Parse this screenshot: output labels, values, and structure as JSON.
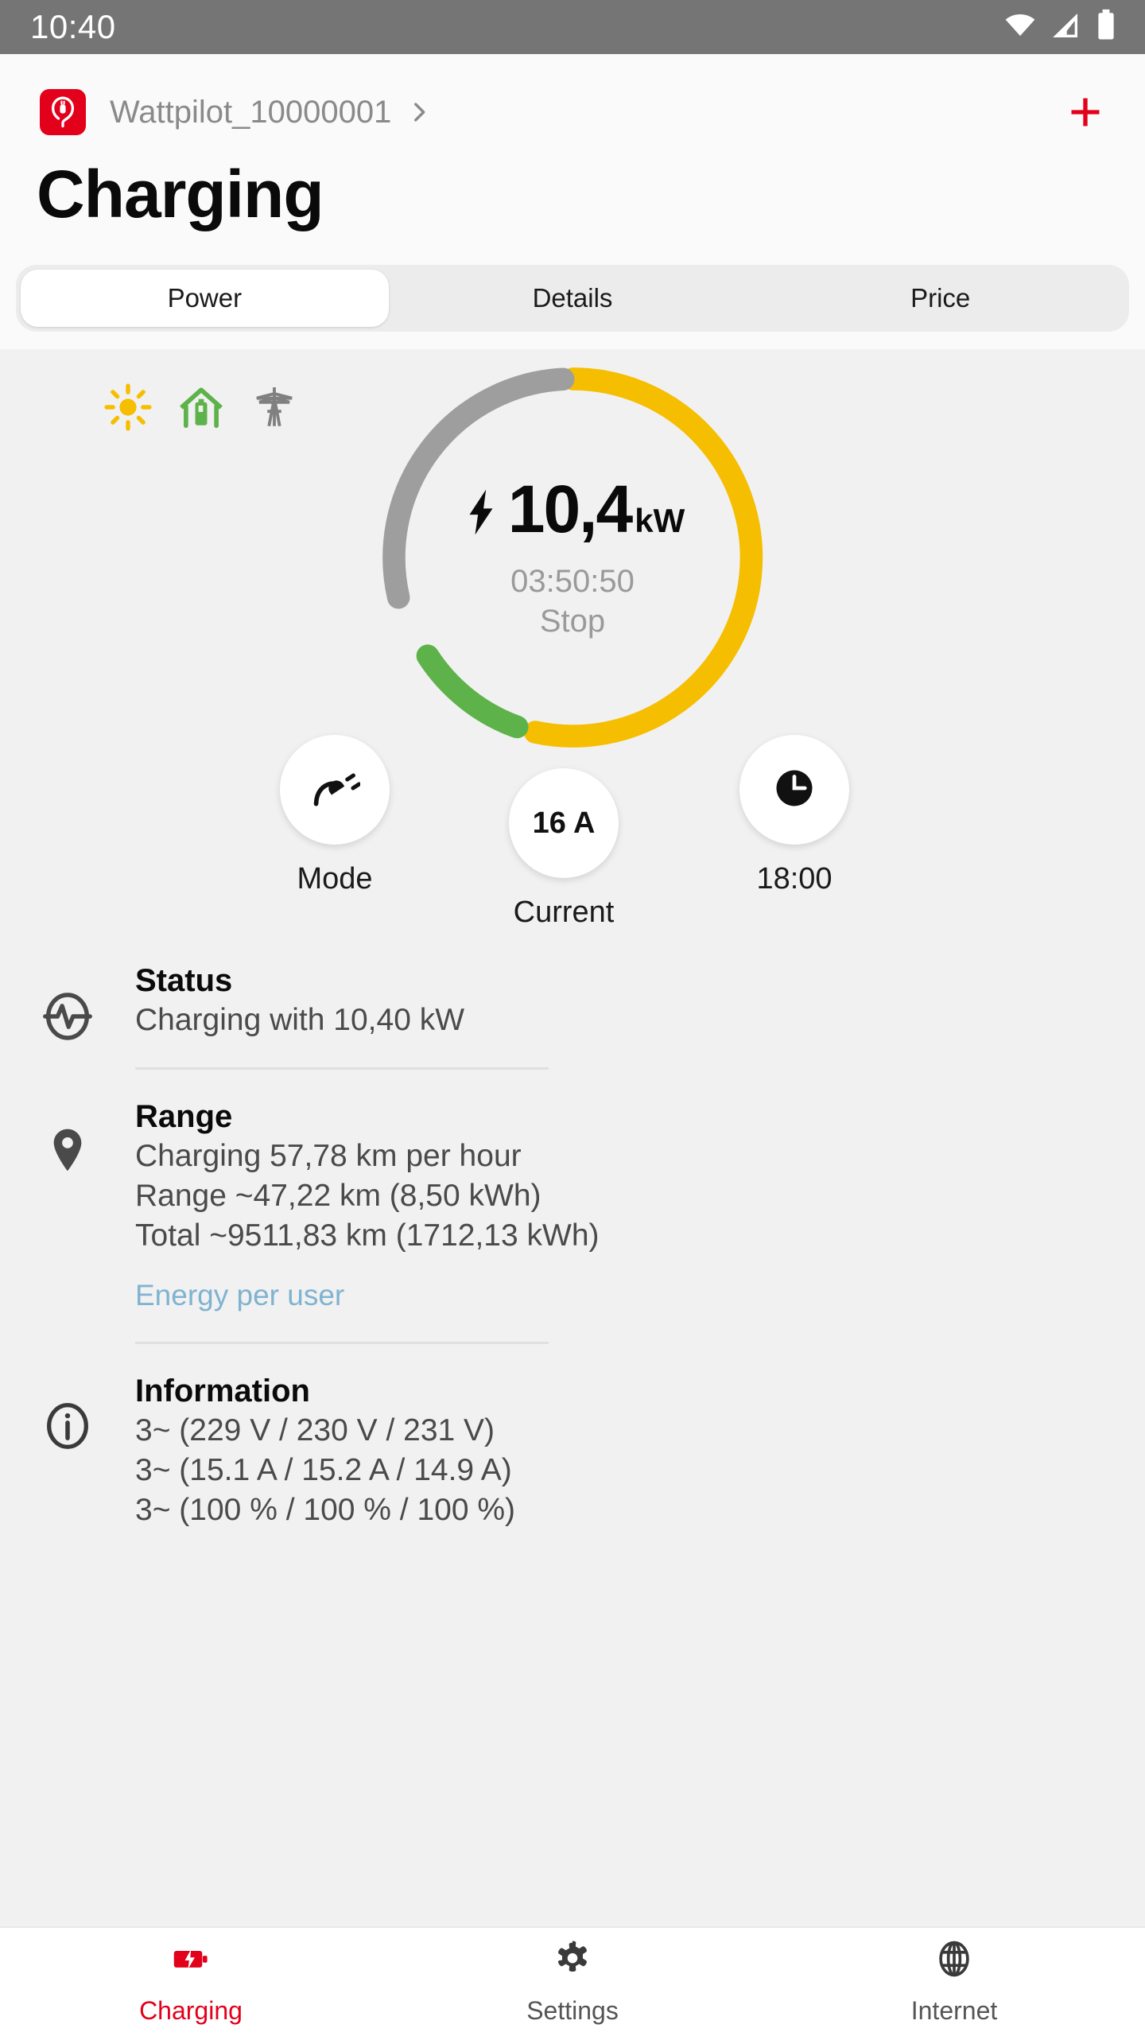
{
  "statusbar": {
    "time": "10:40",
    "icons": [
      "wifi-icon",
      "cellular-signal-icon",
      "battery-icon"
    ]
  },
  "header": {
    "device_logo": "wattpilot-logo-icon",
    "device_name": "Wattpilot_10000001",
    "chevron": "chevron-right-icon",
    "add_label": "+",
    "page_title": "Charging"
  },
  "tabs": [
    {
      "label": "Power",
      "active": true
    },
    {
      "label": "Details",
      "active": false
    },
    {
      "label": "Price",
      "active": false
    }
  ],
  "sources": [
    {
      "name": "solar-sun-icon",
      "color": "#F5BE00"
    },
    {
      "name": "house-battery-icon",
      "color": "#5EB24A"
    },
    {
      "name": "grid-pylon-icon",
      "color": "#808080"
    }
  ],
  "gauge": {
    "power_value": "10,4",
    "power_unit": "kW",
    "bolt_icon": "lightning-bolt-icon",
    "time_remaining": "03:50:50",
    "action_label": "Stop",
    "segments": [
      {
        "name": "solar",
        "color": "#F5BE00",
        "start_deg": 2,
        "end_deg": 192
      },
      {
        "name": "battery",
        "color": "#5EB24A",
        "start_deg": 197,
        "end_deg": 252
      },
      {
        "name": "grid",
        "color": "#9E9E9E",
        "start_deg": 257,
        "end_deg": 357
      }
    ]
  },
  "controls": [
    {
      "icon": "plug-icon",
      "value": "",
      "label": "Mode"
    },
    {
      "icon": "",
      "value": "16 A",
      "label": "Current"
    },
    {
      "icon": "clock-icon",
      "value": "",
      "label": "18:00"
    }
  ],
  "sections": [
    {
      "icon": "activity-pulse-icon",
      "title": "Status",
      "lines": [
        "Charging with 10,40 kW"
      ],
      "link": null
    },
    {
      "icon": "map-pin-icon",
      "title": "Range",
      "lines": [
        "Charging 57,78 km per hour",
        "Range ~47,22 km (8,50 kWh)",
        "Total ~9511,83 km (1712,13 kWh)"
      ],
      "link": "Energy per user"
    },
    {
      "icon": "info-circle-icon",
      "title": "Information",
      "lines": [
        "3~ (229 V / 230 V / 231 V)",
        "3~ (15.1 A / 15.2 A / 14.9 A)",
        "3~ (100 % / 100 % / 100 %)"
      ],
      "link": null
    }
  ],
  "bottomnav": [
    {
      "icon": "charging-battery-icon",
      "label": "Charging",
      "active": true
    },
    {
      "icon": "gear-icon",
      "label": "Settings",
      "active": false
    },
    {
      "icon": "globe-icon",
      "label": "Internet",
      "active": false
    }
  ],
  "colors": {
    "accent": "#E2001A",
    "solar": "#F5BE00",
    "battery": "#5EB24A",
    "grid": "#9E9E9E",
    "link": "#7FB3D1"
  }
}
